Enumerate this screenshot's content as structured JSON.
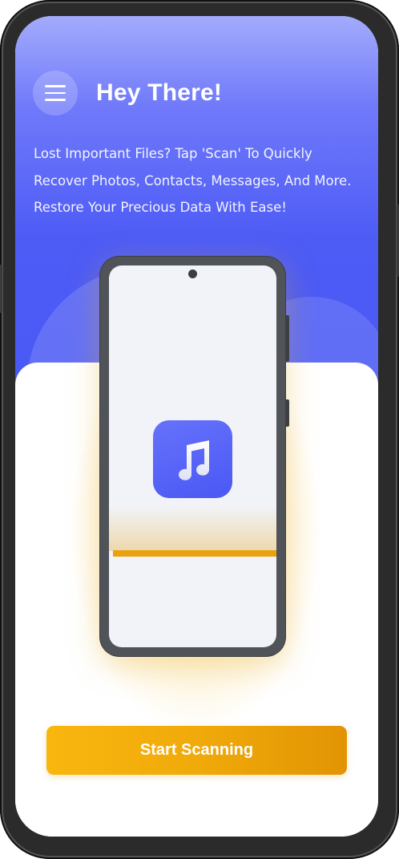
{
  "header": {
    "title": "Hey There!",
    "menu_icon": "hamburger-menu-icon"
  },
  "intro": {
    "description": "Lost Important Files? Tap 'Scan' To Quickly Recover Photos, Contacts, Messages, And More. Restore Your Precious Data With Ease!"
  },
  "illustration": {
    "app_icon": "music-note-icon",
    "scan_line_color": "#e9a20e"
  },
  "actions": {
    "start_label": "Start Scanning"
  },
  "theme": {
    "primary": "#4a59f5",
    "accent": "#f5ad0b",
    "background": "#ffffff"
  }
}
